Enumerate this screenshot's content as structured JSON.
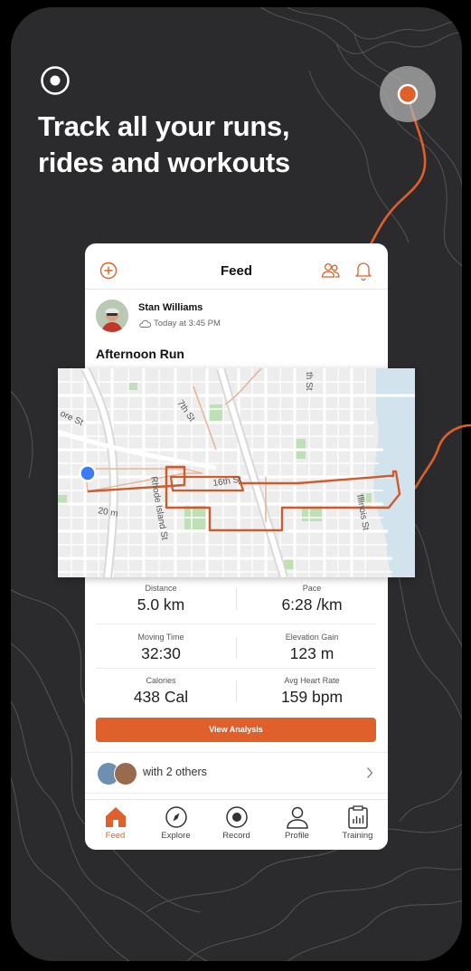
{
  "headline": {
    "line1": "Track all your runs,",
    "line2": "rides and workouts"
  },
  "colors": {
    "accent": "#e0602b",
    "background": "#2b2b2d",
    "map_bg": "#ededee",
    "route": "#cf5a2b",
    "park": "#bfe0b6",
    "water": "#d2e3ee"
  },
  "feed": {
    "title": "Feed",
    "icons": {
      "left": "add-circle-icon",
      "friends": "friends-icon",
      "notifications": "bell-icon"
    },
    "author": {
      "name": "Stan Williams",
      "time": "Today at 3:45 PM",
      "weather_icon": "cloud-icon"
    },
    "activity_title": "Afternoon Run",
    "map": {
      "streets": [
        "ore St",
        "7th St",
        "th St",
        "16th St",
        "Rhode Island St",
        "Illinois St",
        "20 m"
      ]
    },
    "stats": [
      {
        "label": "Distance",
        "value": "5.0 km"
      },
      {
        "label": "Pace",
        "value": "6:28 /km"
      },
      {
        "label": "Moving Time",
        "value": "32:30"
      },
      {
        "label": "Elevation Gain",
        "value": "123 m"
      },
      {
        "label": "Calories",
        "value": "438 Cal"
      },
      {
        "label": "Avg Heart Rate",
        "value": "159 bpm"
      }
    ],
    "view_analysis_label": "View Analysis",
    "with_others_label": "with 2 others",
    "tabs": [
      {
        "label": "Feed",
        "icon": "home-icon",
        "active": true
      },
      {
        "label": "Explore",
        "icon": "compass-icon",
        "active": false
      },
      {
        "label": "Record",
        "icon": "record-icon",
        "active": false
      },
      {
        "label": "Profile",
        "icon": "profile-icon",
        "active": false
      },
      {
        "label": "Training",
        "icon": "training-icon",
        "active": false
      }
    ]
  }
}
